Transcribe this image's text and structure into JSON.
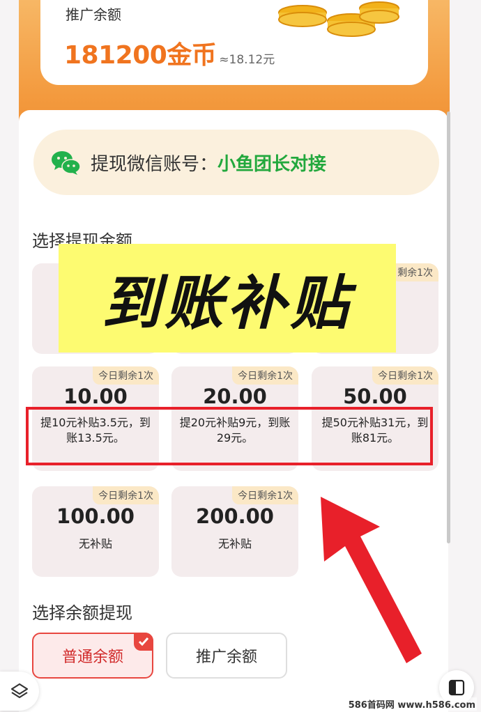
{
  "balance": {
    "label": "推广余额",
    "coins": "181200金币",
    "approx": "≈18.12元"
  },
  "wechat": {
    "label": "提现微信账号：",
    "name": "小鱼团长对接"
  },
  "sections": {
    "amount_title": "选择提现金额",
    "balance_title": "选择余额提现"
  },
  "overlay": {
    "text": "到账补贴",
    "hidden_badge": "剩余1次"
  },
  "amounts": [
    {
      "badge": "今日剩余1次",
      "value": "10.00",
      "note": "提10元补贴3.5元，到账13.5元。"
    },
    {
      "badge": "今日剩余1次",
      "value": "20.00",
      "note": "提20元补贴9元，到账29元。"
    },
    {
      "badge": "今日剩余1次",
      "value": "50.00",
      "note": "提50元补贴31元，到账81元。"
    },
    {
      "badge": "今日剩余1次",
      "value": "100.00",
      "note": "无补贴"
    },
    {
      "badge": "今日剩余1次",
      "value": "200.00",
      "note": "无补贴"
    }
  ],
  "balance_types": {
    "normal": "普通余额",
    "promo": "推广余额",
    "selected": "normal"
  },
  "watermark": "586首码网 www.h586.com",
  "colors": {
    "accent_orange": "#f0741f",
    "wechat_green": "#22a83d",
    "highlight_red": "#e8202a",
    "banner_yellow": "#fdfb71"
  },
  "icons": {
    "wechat": "wechat-icon",
    "coins": "gold-coins-icon",
    "check": "check-icon",
    "layers": "layers-icon",
    "panel": "panel-icon"
  }
}
